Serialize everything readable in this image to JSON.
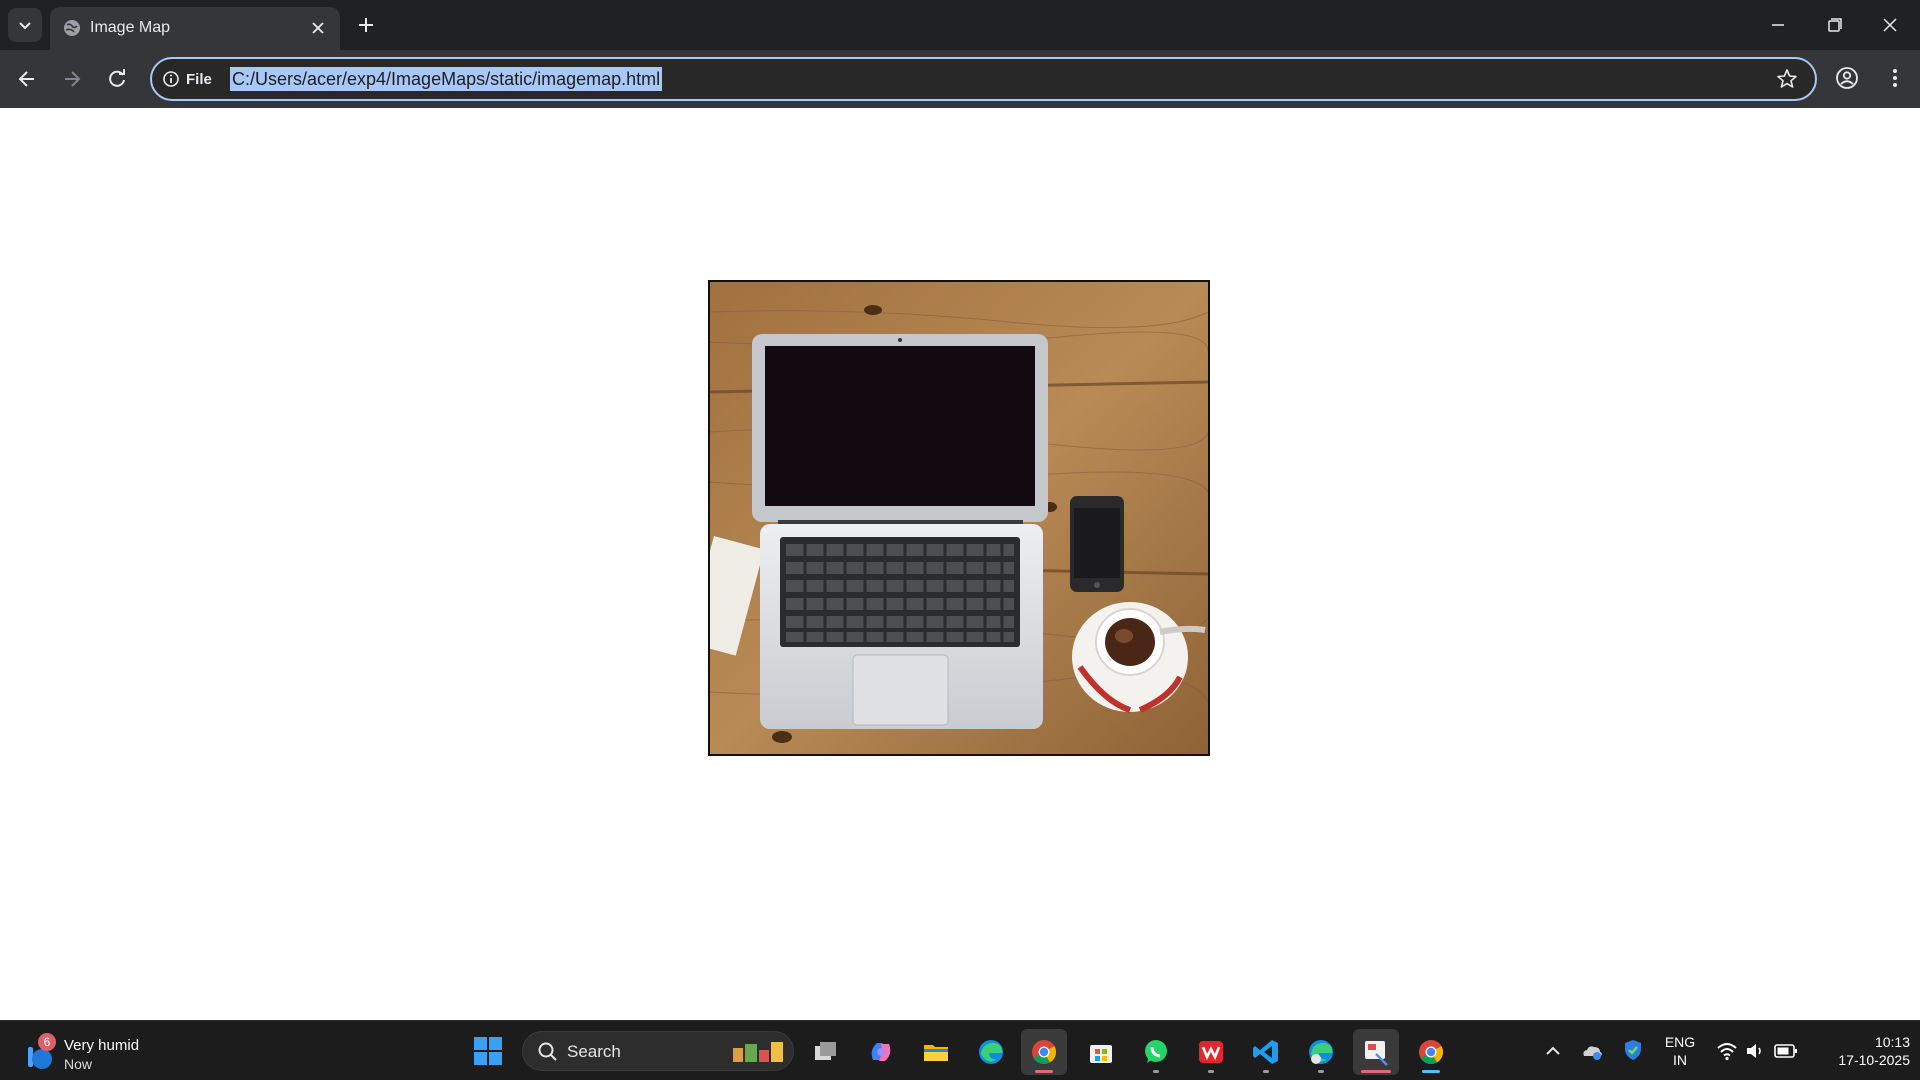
{
  "browser": {
    "tab": {
      "title": "Image Map"
    },
    "address": {
      "scheme_label": "File",
      "url": "C:/Users/acer/exp4/ImageMaps/static/imagemap.html"
    }
  },
  "page": {
    "image": {
      "description_icon": "laptop-desk-photo-icon"
    }
  },
  "taskbar": {
    "weather": {
      "title": "Very humid",
      "subtitle": "Now",
      "badge": "6"
    },
    "search_label": "Search",
    "apps": [
      "task-view",
      "copilot",
      "file-explorer",
      "edge",
      "chrome",
      "microsoft-store",
      "whatsapp",
      "wps-office",
      "vscode",
      "edge-profile",
      "snipping-tool",
      "chrome-active"
    ],
    "language": {
      "line1": "ENG",
      "line2": "IN"
    },
    "clock": {
      "time": "10:13",
      "date": "17-10-2025"
    }
  },
  "colors": {
    "accent": "#a8c7fa",
    "tabstrip": "#202124",
    "toolbar": "#35363a"
  }
}
